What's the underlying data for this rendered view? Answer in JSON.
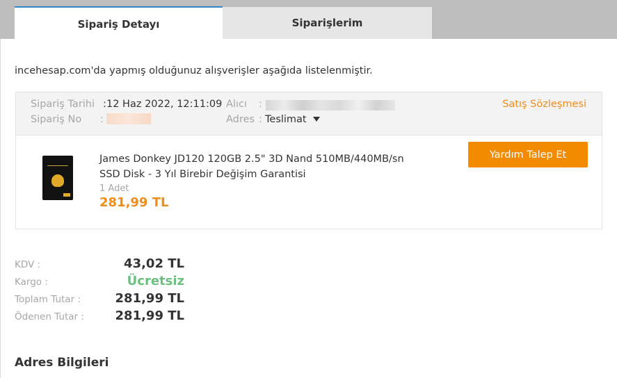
{
  "tabs": {
    "detail_label": "Sipariş Detayı",
    "orders_label": "Siparişlerim"
  },
  "intro_text": "incehesap.com'da yapmış olduğunuz alışverişler aşağıda listelenmiştir.",
  "order": {
    "date_label": "Sipariş Tarihi",
    "date_sep": ":",
    "date_value": "12 Haz 2022, 12:11:09",
    "no_label": "Sipariş No",
    "no_sep": ":",
    "recipient_label": "Alıcı",
    "recipient_sep": ":",
    "address_label": "Adres",
    "address_sep": ":",
    "address_value": "Teslimat",
    "contract_link": "Satış Sözleşmesi"
  },
  "product": {
    "name": "James Donkey JD120 120GB 2.5\" 3D Nand 510MB/440MB/sn SSD Disk - 3 Yıl Birebir Değişim Garantisi",
    "quantity": "1 Adet",
    "price": "281,99 TL",
    "help_button": "Yardım Talep Et"
  },
  "summary": {
    "kdv_label": "KDV :",
    "kdv_value": "43,02 TL",
    "cargo_label": "Kargo :",
    "cargo_value": "Ücretsiz",
    "total_label": "Toplam Tutar :",
    "total_value": "281,99 TL",
    "paid_label": "Ödenen Tutar :",
    "paid_value": "281,99 TL"
  },
  "address_section_title": "Adres Bilgileri",
  "colors": {
    "accent_orange": "#f28b00",
    "tab_active_border": "#2f86c6",
    "free_green": "#6bbf7f"
  }
}
